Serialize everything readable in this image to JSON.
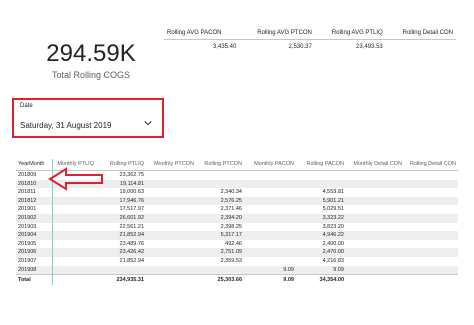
{
  "kpi": {
    "value": "294.59K",
    "label": "Total Rolling COGS"
  },
  "summary": {
    "headers": [
      "Rolling AVG PACON",
      "Rolling AVG PTCON",
      "Rolling AVG PTLIQ",
      "Rolling Detail CON"
    ],
    "values": [
      "3,435.40",
      "2,530.37",
      "23,493.53",
      ""
    ]
  },
  "slicer": {
    "title": "Date",
    "value": "Saturday, 31 August 2019",
    "chevron_icon": "chevron-down-icon"
  },
  "grid": {
    "headers": [
      "YearMonth",
      "Monthly PTLIQ",
      "Rolling PTLIQ",
      "Monthly PTCON",
      "Rolling PTCON",
      "Monthly PACON",
      "Rolling PACON",
      "Monthly Detail CON",
      "Rolling Detail CON"
    ],
    "rows": [
      [
        "201809",
        "",
        "23,362.75",
        "",
        "",
        "",
        "",
        "",
        ""
      ],
      [
        "201810",
        "",
        "19,114.81",
        "",
        "",
        "",
        "",
        "",
        ""
      ],
      [
        "201811",
        "",
        "19,000.63",
        "",
        "2,340.34",
        "",
        "4,553.81",
        "",
        ""
      ],
      [
        "201812",
        "",
        "17,946.76",
        "",
        "2,576.25",
        "",
        "5,901.21",
        "",
        ""
      ],
      [
        "201901",
        "",
        "17,517.97",
        "",
        "2,371.46",
        "",
        "5,029.51",
        "",
        ""
      ],
      [
        "201902",
        "",
        "26,601.92",
        "",
        "2,394.20",
        "",
        "3,323.22",
        "",
        ""
      ],
      [
        "201903",
        "",
        "22,561.21",
        "",
        "2,398.25",
        "",
        "3,823.20",
        "",
        ""
      ],
      [
        "201904",
        "",
        "21,852.94",
        "",
        "5,317.17",
        "",
        "4,946.22",
        "",
        ""
      ],
      [
        "201905",
        "",
        "23,489.76",
        "",
        "492.46",
        "",
        "2,400.00",
        "",
        ""
      ],
      [
        "201906",
        "",
        "23,426.42",
        "",
        "2,751.09",
        "",
        "2,470.00",
        "",
        ""
      ],
      [
        "201907",
        "",
        "21,852.94",
        "",
        "2,359.53",
        "",
        "4,216.83",
        "",
        ""
      ],
      [
        "201908",
        "",
        "",
        "",
        "",
        "9.09",
        "9.09",
        "",
        ""
      ]
    ],
    "total": [
      "Total",
      "",
      "234,935.31",
      "",
      "25,303.66",
      "9.09",
      "34,354.00",
      "",
      ""
    ]
  },
  "annotation": {
    "arrow_color": "#e0202c"
  }
}
